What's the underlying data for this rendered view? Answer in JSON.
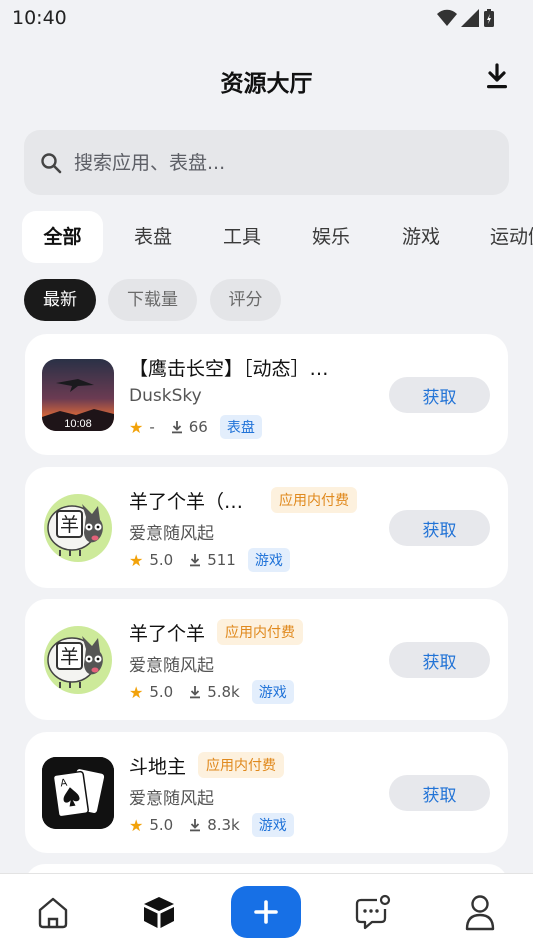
{
  "status_bar": {
    "time": "10:40"
  },
  "header": {
    "title": "资源大厅"
  },
  "search": {
    "placeholder": "搜索应用、表盘..."
  },
  "tabs": [
    {
      "label": "全部",
      "active": true
    },
    {
      "label": "表盘"
    },
    {
      "label": "工具"
    },
    {
      "label": "娱乐"
    },
    {
      "label": "游戏"
    },
    {
      "label": "运动健"
    }
  ],
  "sort_options": [
    {
      "label": "最新",
      "active": true
    },
    {
      "label": "下载量"
    },
    {
      "label": "评分"
    }
  ],
  "apps": [
    {
      "name": "【鹰击长空】［动态］…",
      "developer": "DuskSky",
      "rating": "-",
      "downloads": "66",
      "category": "表盘",
      "iap": "",
      "action": "获取",
      "icon": "jet-watchface-icon",
      "icon_time": "10:08"
    },
    {
      "name": "羊了个羊（…",
      "developer": "爱意随风起",
      "rating": "5.0",
      "downloads": "511",
      "category": "游戏",
      "iap": "应用内付费",
      "action": "获取",
      "icon": "sheep-game-icon",
      "icon_char": "羊"
    },
    {
      "name": "羊了个羊",
      "developer": "爱意随风起",
      "rating": "5.0",
      "downloads": "5.8k",
      "category": "游戏",
      "iap": "应用内付费",
      "action": "获取",
      "icon": "sheep-game-icon",
      "icon_char": "羊"
    },
    {
      "name": "斗地主",
      "developer": "爱意随风起",
      "rating": "5.0",
      "downloads": "8.3k",
      "category": "游戏",
      "iap": "应用内付费",
      "action": "获取",
      "icon": "playing-cards-icon",
      "icon_char": "A"
    }
  ],
  "bottom_nav": [
    {
      "icon": "home-icon"
    },
    {
      "icon": "cube-icon",
      "active": true
    },
    {
      "icon": "plus-icon"
    },
    {
      "icon": "chat-bubble-icon"
    },
    {
      "icon": "profile-icon"
    }
  ],
  "colors": {
    "accent": "#1770e6",
    "star": "#f2a20a",
    "iap_text": "#e0891d",
    "category_text": "#2173d8"
  }
}
